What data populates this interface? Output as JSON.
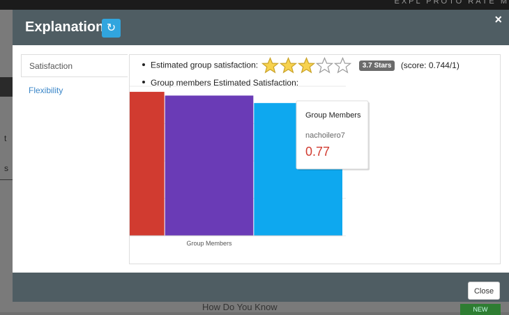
{
  "background": {
    "topnav": "EXPL PROTO  RATE M",
    "frag1": "t",
    "frag2": "s",
    "bottom_text": "How Do You Know",
    "green_badge": "NEW"
  },
  "modal": {
    "title": "Explanations",
    "refresh_icon": "refresh-icon",
    "close_glyph": "×",
    "close_button": "Close"
  },
  "tabs": [
    {
      "label": "Satisfaction",
      "active": true
    },
    {
      "label": "Flexibility",
      "active": false
    }
  ],
  "satisfaction": {
    "label": "Estimated group satisfaction:",
    "stars": 3.7,
    "stars_max": 5,
    "badge": "3.7 Stars",
    "score": "(score: 0.744/1)",
    "members_label": "Group members Estimated Satisfaction:"
  },
  "chart_data": {
    "type": "bar",
    "categories": [
      "Group Members"
    ],
    "series": [
      {
        "name": "nachoilero7",
        "values": [
          0.77
        ],
        "color": "#d13b30"
      },
      {
        "values": [
          0.75
        ],
        "color": "#6a3bb6"
      },
      {
        "values": [
          0.71
        ],
        "color": "#0ea8ef"
      }
    ],
    "ylim": [
      0,
      0.8
    ],
    "yticks": [
      "0",
      "0.2",
      "0.4",
      "0.6",
      "0.8"
    ],
    "xlabel": "Group Members",
    "grid": true,
    "tooltip": {
      "title": "Group Members",
      "series": "nachoilero7",
      "value": "0.77",
      "value_color": "#d13b30"
    }
  }
}
